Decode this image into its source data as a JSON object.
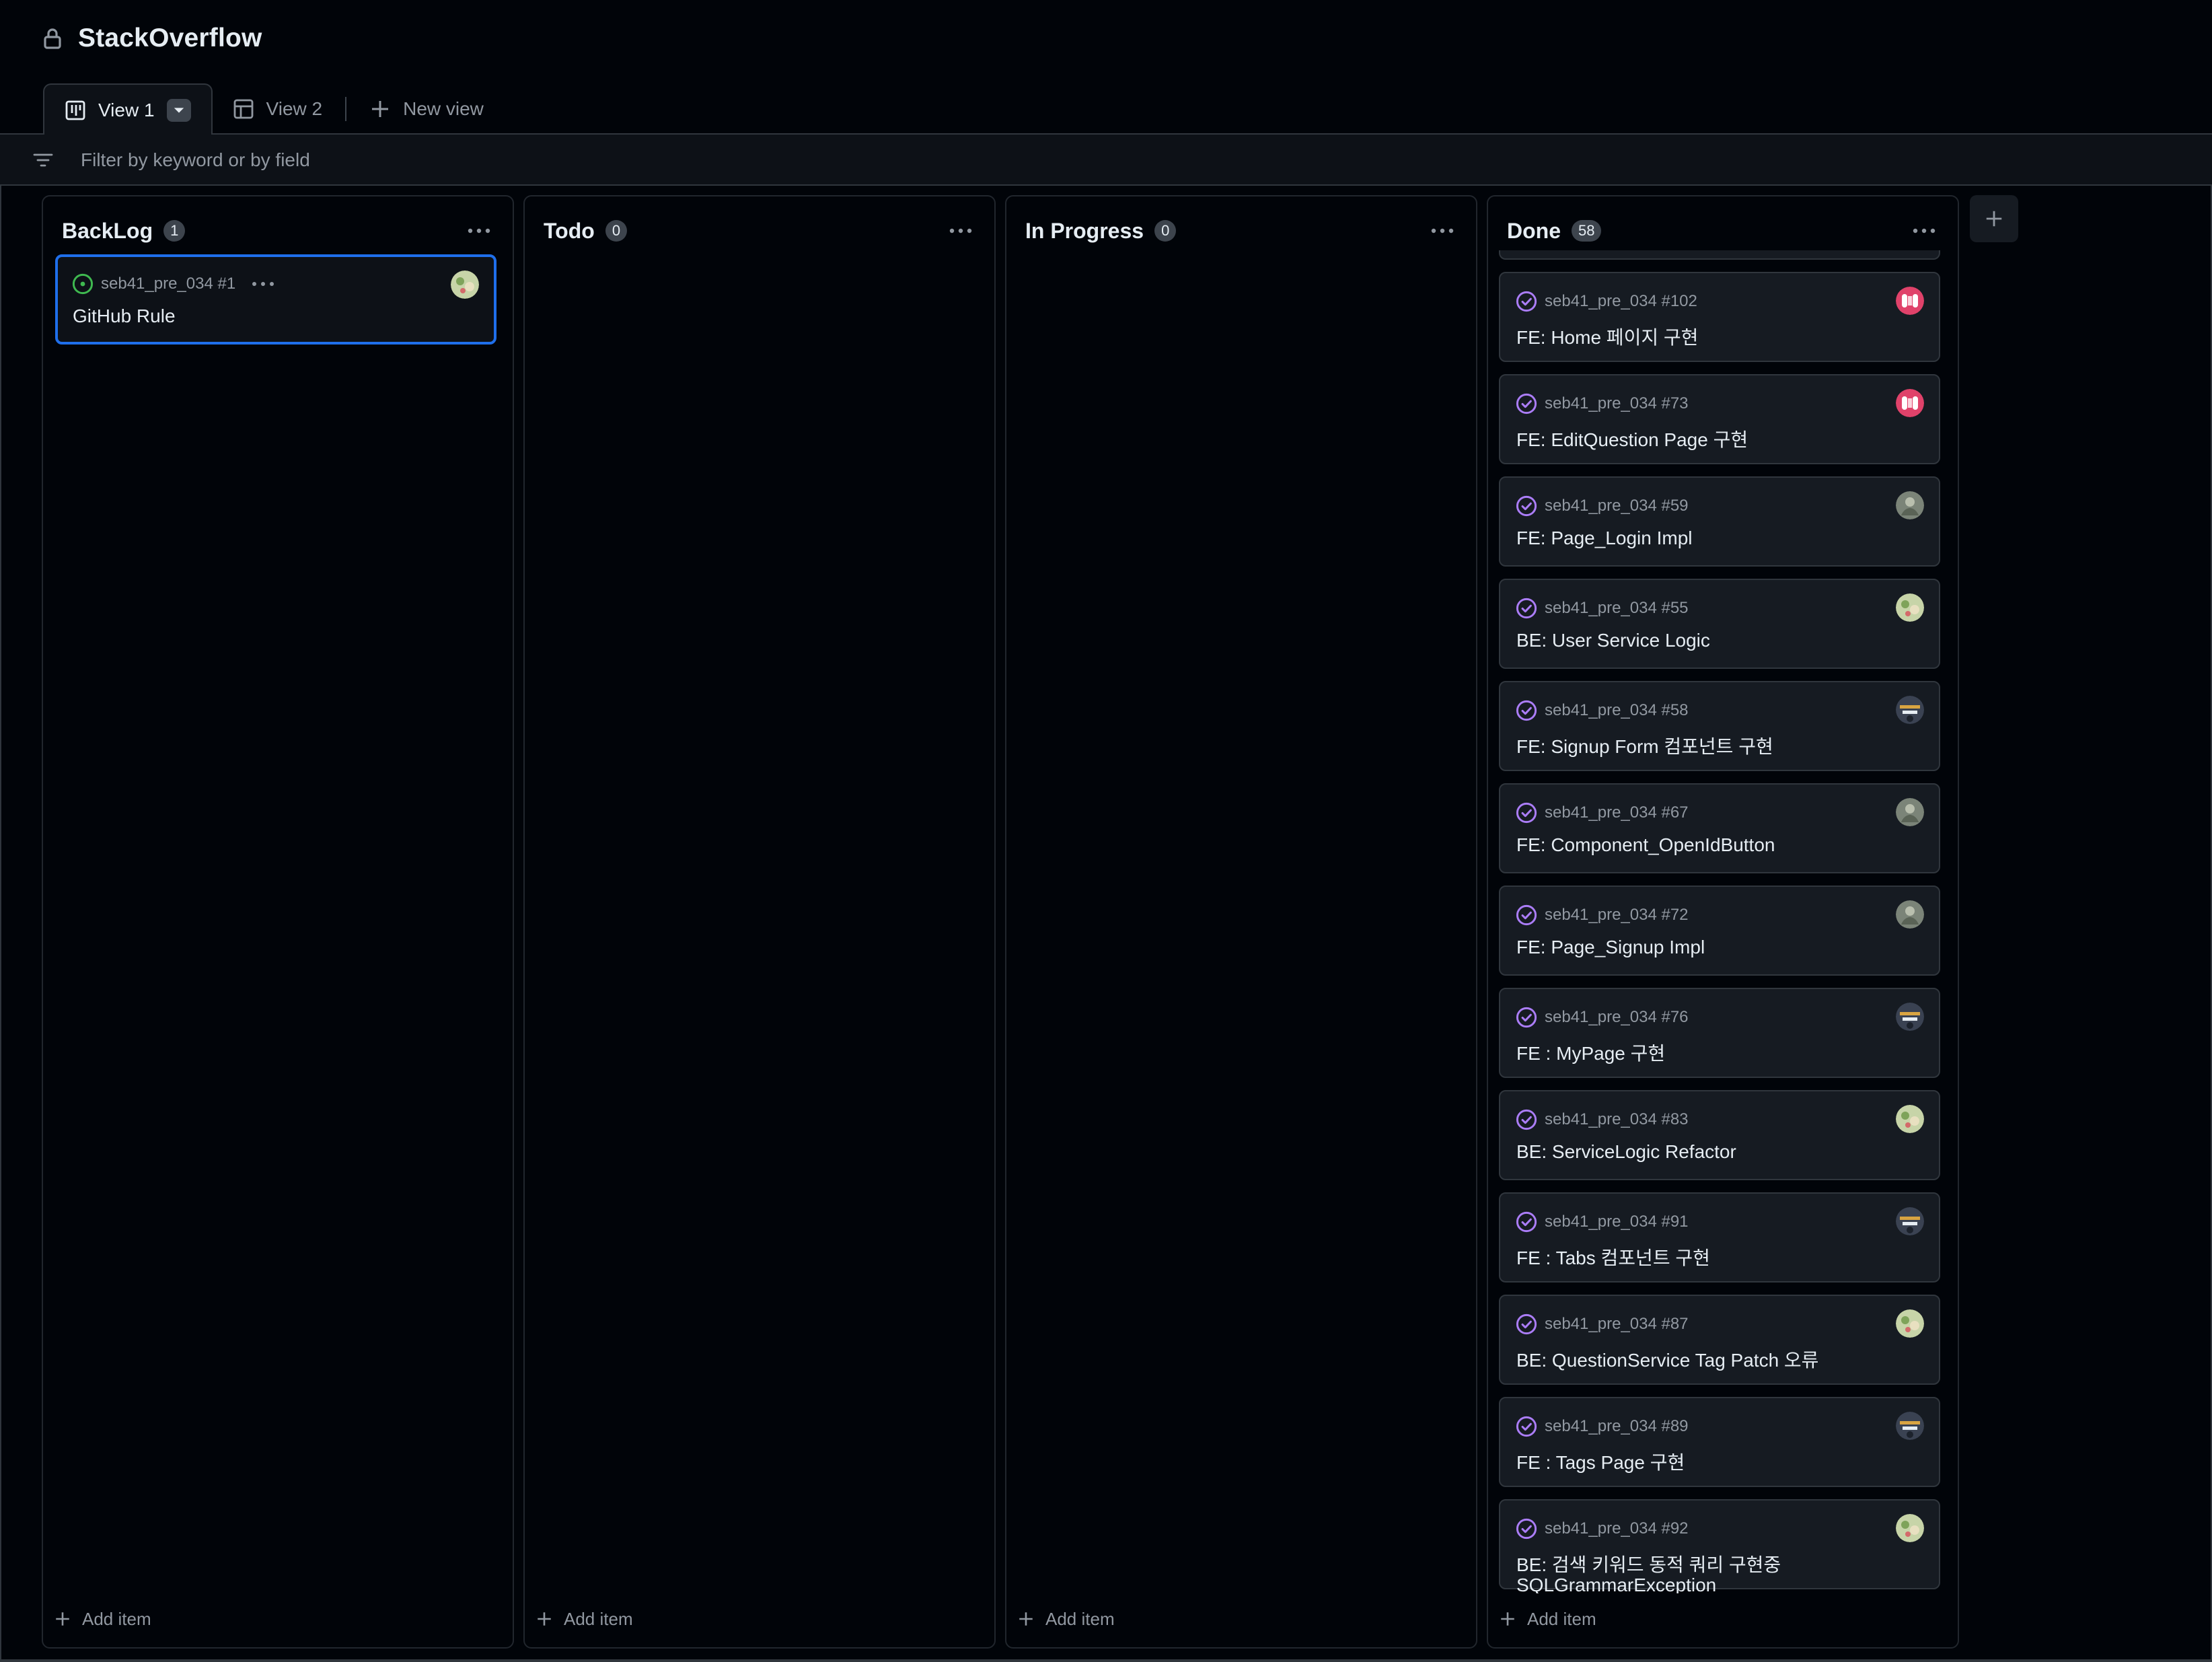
{
  "header": {
    "title": "StackOverflow",
    "lock_icon": "lock-icon"
  },
  "tabs": [
    {
      "label": "View 1",
      "icon": "board-icon",
      "active": true
    },
    {
      "label": "View 2",
      "icon": "table-icon",
      "active": false
    },
    {
      "label": "New view",
      "icon": "plus-icon",
      "active": false
    }
  ],
  "filter": {
    "placeholder": "Filter by keyword or by field"
  },
  "columns": [
    {
      "name": "BackLog",
      "count": "1",
      "add_label": "Add item",
      "cards": [
        {
          "ref": "seb41_pre_034 #1",
          "title": "GitHub Rule",
          "status": "open",
          "avatar": "avatar-green"
        }
      ]
    },
    {
      "name": "Todo",
      "count": "0",
      "add_label": "Add item",
      "cards": []
    },
    {
      "name": "In Progress",
      "count": "0",
      "add_label": "Add item",
      "cards": []
    },
    {
      "name": "Done",
      "count": "58",
      "add_label": "Add item",
      "cards": [
        {
          "ref": "seb41_pre_034 #102",
          "title": "FE: Home 페이지 구현",
          "status": "closed",
          "avatar": "avatar-pink"
        },
        {
          "ref": "seb41_pre_034 #73",
          "title": "FE: EditQuestion Page 구현",
          "status": "closed",
          "avatar": "avatar-pink"
        },
        {
          "ref": "seb41_pre_034 #59",
          "title": "FE: Page_Login Impl",
          "status": "closed",
          "avatar": "avatar-gray"
        },
        {
          "ref": "seb41_pre_034 #55",
          "title": "BE: User Service Logic",
          "status": "closed",
          "avatar": "avatar-green"
        },
        {
          "ref": "seb41_pre_034 #58",
          "title": "FE: Signup Form 컴포넌트 구현",
          "status": "closed",
          "avatar": "avatar-dark"
        },
        {
          "ref": "seb41_pre_034 #67",
          "title": "FE: Component_OpenIdButton",
          "status": "closed",
          "avatar": "avatar-gray"
        },
        {
          "ref": "seb41_pre_034 #72",
          "title": "FE: Page_Signup Impl",
          "status": "closed",
          "avatar": "avatar-gray"
        },
        {
          "ref": "seb41_pre_034 #76",
          "title": "FE : MyPage 구현",
          "status": "closed",
          "avatar": "avatar-dark"
        },
        {
          "ref": "seb41_pre_034 #83",
          "title": "BE: ServiceLogic Refactor",
          "status": "closed",
          "avatar": "avatar-green"
        },
        {
          "ref": "seb41_pre_034 #91",
          "title": "FE : Tabs 컴포넌트 구현",
          "status": "closed",
          "avatar": "avatar-dark"
        },
        {
          "ref": "seb41_pre_034 #87",
          "title": "BE: QuestionService Tag Patch 오류",
          "status": "closed",
          "avatar": "avatar-green"
        },
        {
          "ref": "seb41_pre_034 #89",
          "title": "FE : Tags Page 구현",
          "status": "closed",
          "avatar": "avatar-dark"
        },
        {
          "ref": "seb41_pre_034 #92",
          "title": "BE: 검색 키워드 동적 쿼리 구현중",
          "title2": "SQLGrammarException",
          "status": "closed",
          "avatar": "avatar-green"
        }
      ]
    }
  ],
  "colors": {
    "open_status": "#3fb950",
    "closed_status": "#ab7df8",
    "selected_border": "#1f6feb"
  }
}
